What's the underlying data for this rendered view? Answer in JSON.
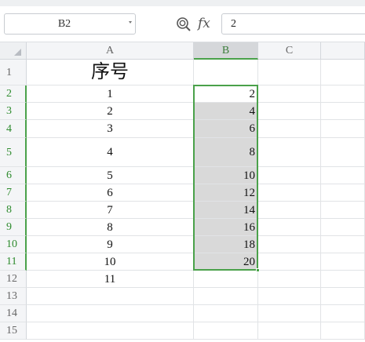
{
  "formula_bar": {
    "name_box": "B2",
    "zoom_icon": "magnifier-zoom-icon",
    "fx_label": "fx",
    "formula_value": "2"
  },
  "sheet": {
    "columns": [
      "A",
      "B",
      "C"
    ],
    "selected_column": "B",
    "selected_range": "B2:B11",
    "rows": [
      {
        "num": "1",
        "a": "序号",
        "b": ""
      },
      {
        "num": "2",
        "a": "1",
        "b": "2"
      },
      {
        "num": "3",
        "a": "2",
        "b": "4"
      },
      {
        "num": "4",
        "a": "3",
        "b": "6"
      },
      {
        "num": "5",
        "a": "4",
        "b": "8"
      },
      {
        "num": "6",
        "a": "5",
        "b": "10"
      },
      {
        "num": "7",
        "a": "6",
        "b": "12"
      },
      {
        "num": "8",
        "a": "7",
        "b": "14"
      },
      {
        "num": "9",
        "a": "8",
        "b": "16"
      },
      {
        "num": "10",
        "a": "9",
        "b": "18"
      },
      {
        "num": "11",
        "a": "10",
        "b": "20"
      },
      {
        "num": "12",
        "a": "11",
        "b": ""
      },
      {
        "num": "13",
        "a": "",
        "b": ""
      },
      {
        "num": "14",
        "a": "",
        "b": ""
      },
      {
        "num": "15",
        "a": "",
        "b": ""
      }
    ]
  },
  "colors": {
    "selection": "#4aa14a",
    "selected_fill": "#d9d9d9"
  }
}
